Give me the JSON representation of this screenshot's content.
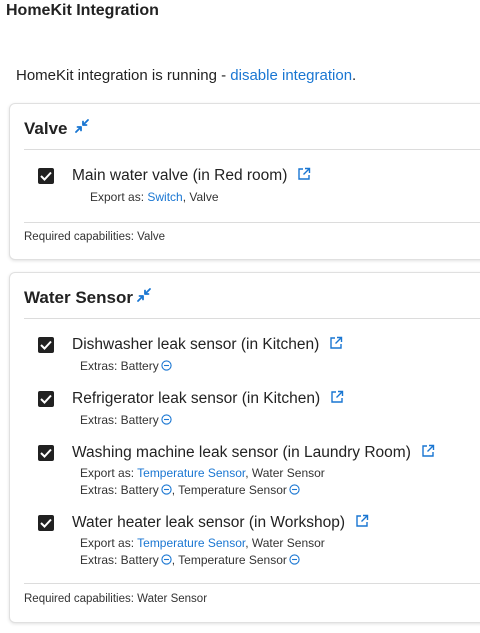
{
  "page_title": "HomeKit Integration",
  "status": {
    "text": "HomeKit integration is running - ",
    "link": "disable integration",
    "suffix": "."
  },
  "colors": {
    "accent": "#1976d2",
    "checkbox": "#212121"
  },
  "cards": [
    {
      "title": "Valve",
      "devices": [
        {
          "name": "Main water valve (in Red room)",
          "checked": true,
          "export_label": "Export as: ",
          "export_link": "Switch",
          "export_rest": ", Valve"
        }
      ],
      "required": "Required capabilities: Valve"
    },
    {
      "title": "Water Sensor",
      "devices": [
        {
          "name": "Dishwasher leak sensor (in Kitchen)",
          "checked": true,
          "extras_label": "Extras: Battery"
        },
        {
          "name": "Refrigerator leak sensor (in Kitchen)",
          "checked": true,
          "extras_label": "Extras: Battery"
        },
        {
          "name": "Washing machine leak sensor (in Laundry Room)",
          "checked": true,
          "export_label": "Export as: ",
          "export_link": "Temperature Sensor",
          "export_rest": ", Water Sensor",
          "extras_label": "Extras: Battery",
          "extras_second": ", Temperature Sensor"
        },
        {
          "name": "Water heater leak sensor (in Workshop)",
          "checked": true,
          "export_label": "Export as: ",
          "export_link": "Temperature Sensor",
          "export_rest": ", Water Sensor",
          "extras_label": "Extras: Battery",
          "extras_second": ", Temperature Sensor"
        }
      ],
      "required": "Required capabilities: Water Sensor"
    }
  ],
  "icons": {
    "collapse": "collapse-arrows-icon",
    "external": "external-link-icon",
    "remove": "minus-circle-icon",
    "check": "check-icon"
  }
}
